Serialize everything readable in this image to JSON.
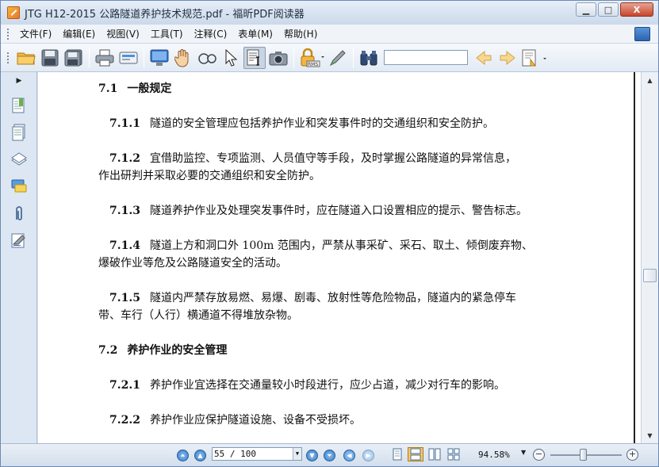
{
  "window": {
    "title": "JTG H12-2015 公路隧道养护技术规范.pdf - 福昕PDF阅读器",
    "minimize": "▁",
    "maximize": "□",
    "close": "X"
  },
  "menubar": {
    "items": [
      {
        "label": "文件(F)"
      },
      {
        "label": "编辑(E)"
      },
      {
        "label": "视图(V)"
      },
      {
        "label": "工具(T)"
      },
      {
        "label": "注释(C)"
      },
      {
        "label": "表单(M)"
      },
      {
        "label": "帮助(H)"
      }
    ]
  },
  "toolbar": {
    "icons": [
      "open-folder",
      "save",
      "save-as",
      "print",
      "scan",
      "full-screen",
      "hand-tool",
      "zoom-tool",
      "select-arrow",
      "text-select",
      "snapshot",
      "rms-lock",
      "sign",
      "find-binoculars"
    ],
    "search_placeholder": ""
  },
  "document": {
    "lines": [
      {
        "num": "7.1",
        "text": "一般规定"
      },
      {
        "num": "7.1.1",
        "text": "隧道的安全管理应包括养护作业和突发事件时的交通组织和安全防护。"
      },
      {
        "num": "7.1.2",
        "text": "宜借助监控、专项监测、人员值守等手段，及时掌握公路隧道的异常信息，"
      },
      {
        "num": "",
        "text": "作出研判并采取必要的交通组织和安全防护。"
      },
      {
        "num": "7.1.3",
        "text": "隧道养护作业及处理突发事件时，应在隧道入口设置相应的提示、警告标志。"
      },
      {
        "num": "7.1.4",
        "text": "隧道上方和洞口外 100m 范围内，严禁从事采矿、采石、取土、倾倒废弃物、"
      },
      {
        "num": "",
        "text": "爆破作业等危及公路隧道安全的活动。"
      },
      {
        "num": "7.1.5",
        "text": "隧道内严禁存放易燃、易爆、剧毒、放射性等危险物品，隧道内的紧急停车"
      },
      {
        "num": "",
        "text": "带、车行（人行）横通道不得堆放杂物。"
      },
      {
        "num": "7.2",
        "text": "养护作业的安全管理"
      },
      {
        "num": "7.2.1",
        "text": "养护作业宜选择在交通量较小时段进行，应少占道，减少对行车的影响。"
      },
      {
        "num": "7.2.2",
        "text": "养护作业应保护隧道设施、设备不受损坏。"
      }
    ]
  },
  "statusbar": {
    "page_indicator": "55 / 100",
    "current_page": 55,
    "total_pages": 100,
    "zoom": "94.58%",
    "zoom_level": 0.4
  },
  "colors": {
    "titlebar": "#d3dfec",
    "close_button": "#c7452b",
    "accent": "#3478c4"
  }
}
